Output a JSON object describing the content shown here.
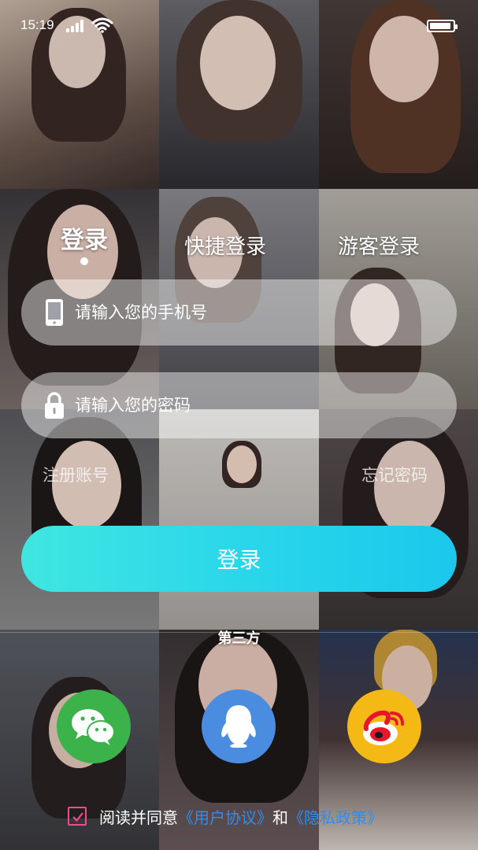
{
  "status_bar": {
    "time": "15:19"
  },
  "tabs": [
    {
      "label": "登录",
      "active": true
    },
    {
      "label": "快捷登录",
      "active": false
    },
    {
      "label": "游客登录",
      "active": false
    }
  ],
  "phone_field": {
    "placeholder": "请输入您的手机号",
    "icon": "phone-icon"
  },
  "password_field": {
    "placeholder": "请输入您的密码",
    "icon": "lock-icon"
  },
  "links": {
    "register": "注册账号",
    "forgot": "忘记密码"
  },
  "login_button": {
    "label": "登录"
  },
  "third_party": {
    "title": "第三方",
    "providers": [
      {
        "name": "wechat",
        "icon": "wechat-icon",
        "color": "#3bb34a"
      },
      {
        "name": "qq",
        "icon": "qq-icon",
        "color": "#4a8de0"
      },
      {
        "name": "weibo",
        "icon": "weibo-icon",
        "color": "#f5b915"
      }
    ]
  },
  "agreement": {
    "checked": true,
    "prefix": "阅读并同意",
    "user_agreement": "《用户协议》",
    "and": "和",
    "privacy_policy": "《隐私政策》"
  },
  "colors": {
    "accent_start": "#3fe6e0",
    "accent_end": "#1bc8ec",
    "link": "#2f8df0",
    "checkbox": "#e94f8a"
  }
}
